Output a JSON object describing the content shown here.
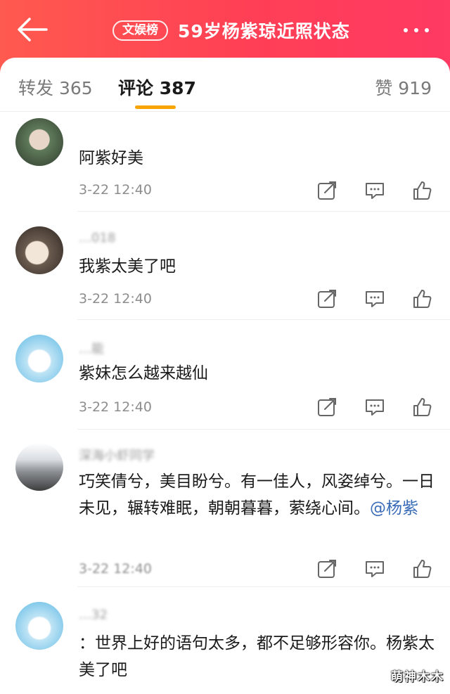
{
  "header": {
    "badge": "文娱榜",
    "title": "59岁杨紫琼近照状态",
    "back_icon": "arrow-left-icon",
    "more_icon": "more-dots-icon"
  },
  "tabs": {
    "repost": "转发 365",
    "comments": "评论 387",
    "likes": "赞 919"
  },
  "colors": {
    "header_start": "#ff5a4f",
    "header_end": "#ff3a63",
    "tab_indicator": "#f7a400",
    "mention": "#3a6cb8"
  },
  "comments": [
    {
      "username": "",
      "text": "阿紫好美",
      "time": "3-22 12:40"
    },
    {
      "username": "…018",
      "text": "我紫太美了吧",
      "time": "3-22 12:40"
    },
    {
      "username": "…能",
      "text": "紫妹怎么越来越仙",
      "time": "3-22 12:40"
    },
    {
      "username": "深海小虾同学",
      "text": "巧笑倩兮，美目盼兮。有一佳人，风姿绰兮。一日未见，辗转难眠，朝朝暮暮，萦绕心间。",
      "mention": "@杨紫",
      "time": "3-22 12:40"
    },
    {
      "username": "…32",
      "text": "：世界上好的语句太多，都不足够形容你。杨紫太美了吧"
    }
  ],
  "watermark": "萌神木木"
}
